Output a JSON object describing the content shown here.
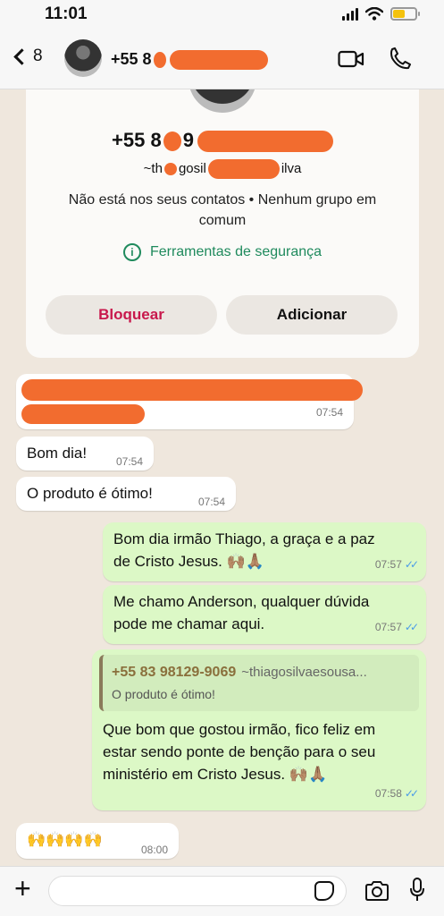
{
  "status_bar": {
    "time": "11:01",
    "battery_level": 0.55
  },
  "header": {
    "back_count": "8",
    "title_prefix": "+55 8"
  },
  "contact_info": {
    "number_prefix": "+55 8",
    "number_middle": "9",
    "username_prefix": "~th",
    "username_middle": "gosil",
    "username_suffix": "ilva",
    "note": "Não está nos seus contatos • Nenhum grupo em comum",
    "safety_tools": "Ferramentas de segurança",
    "block_label": "Bloquear",
    "add_label": "Adicionar"
  },
  "messages": [
    {
      "id": "m1",
      "direction": "in",
      "text": "",
      "time": "07:54"
    },
    {
      "id": "m2",
      "direction": "in",
      "text": "Bom dia!",
      "time": "07:54"
    },
    {
      "id": "m3",
      "direction": "in",
      "text": "O produto é ótimo!",
      "time": "07:54"
    },
    {
      "id": "m4",
      "direction": "out",
      "text": "Bom dia irmão Thiago, a graça e a paz de Cristo Jesus. 🙌🏽🙏🏽",
      "time": "07:57"
    },
    {
      "id": "m5",
      "direction": "out",
      "text": "Me chamo Anderson, qualquer dúvida pode me chamar aqui.",
      "time": "07:57"
    },
    {
      "id": "m6",
      "direction": "out",
      "quote": {
        "sender": "+55 83 98129-9069",
        "user": "~thiagosilvaesousa...",
        "text": "O produto é ótimo!"
      },
      "text": "Que bom que gostou irmão, fico feliz em estar sendo ponte de benção para o seu ministério em Cristo Jesus. 🙌🏽🙏🏽",
      "time": "07:58"
    },
    {
      "id": "m7",
      "direction": "in",
      "text": "🙌🙌🙌🙌",
      "time": "08:00"
    }
  ],
  "composer": {
    "placeholder": ""
  },
  "colors": {
    "accent_green": "#1f8a5d",
    "block_red": "#c8184c",
    "out_bubble": "#dcf8c6",
    "redaction": "#f26c2f",
    "read_ticks": "#4a9be8"
  },
  "icons": [
    "back-chevron-icon",
    "video-call-icon",
    "phone-call-icon",
    "info-icon",
    "plus-icon",
    "sticker-icon",
    "camera-icon",
    "microphone-icon",
    "read-receipt-icon"
  ]
}
